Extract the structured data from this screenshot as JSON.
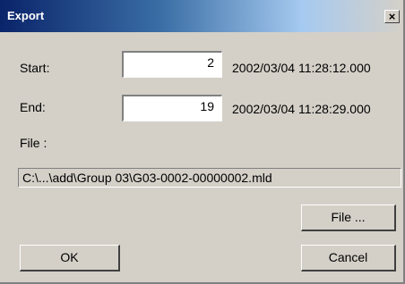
{
  "window": {
    "title": "Export",
    "close_glyph": "×"
  },
  "form": {
    "start_label": "Start:",
    "start_value": "2",
    "start_time": "2002/03/04 11:28:12.000",
    "end_label": "End:",
    "end_value": "19",
    "end_time": "2002/03/04 11:28:29.000",
    "file_label": "File :",
    "file_path": "C:\\...\\add\\Group 03\\G03-0002-00000002.mld"
  },
  "buttons": {
    "file": "File ...",
    "ok": "OK",
    "cancel": "Cancel"
  }
}
